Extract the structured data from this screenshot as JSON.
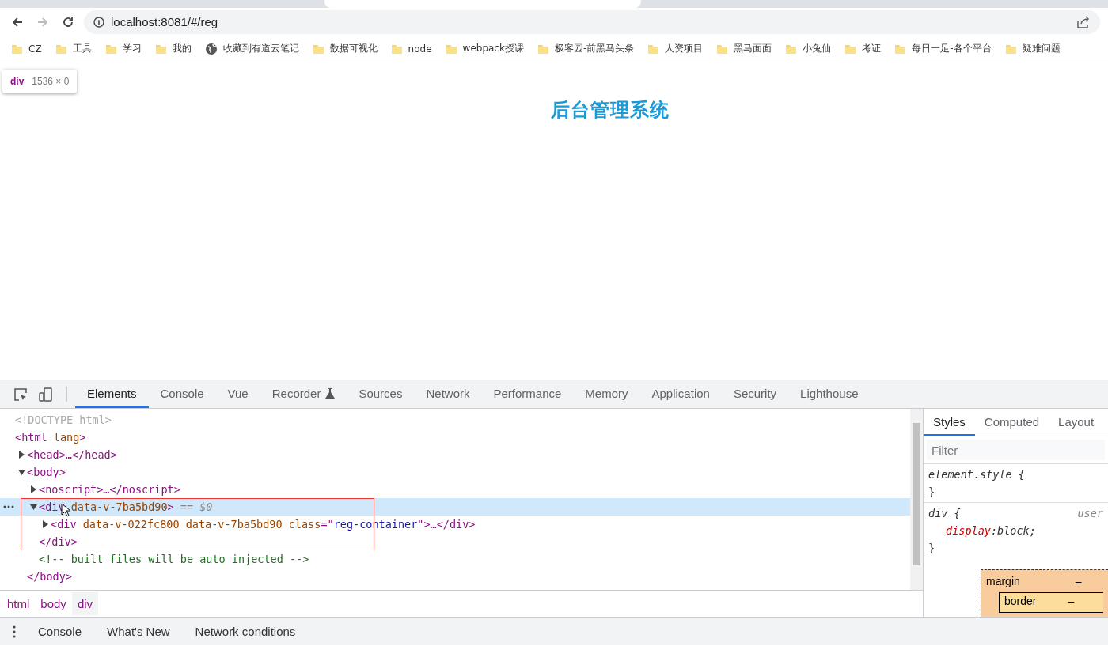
{
  "browser": {
    "url": "localhost:8081/#/reg",
    "bookmarks": [
      {
        "kind": "folder",
        "label": "CZ"
      },
      {
        "kind": "folder",
        "label": "工具"
      },
      {
        "kind": "folder",
        "label": "学习"
      },
      {
        "kind": "folder",
        "label": "我的"
      },
      {
        "kind": "globe",
        "label": "收藏到有道云笔记"
      },
      {
        "kind": "folder",
        "label": "数据可视化"
      },
      {
        "kind": "folder",
        "label": "node"
      },
      {
        "kind": "folder",
        "label": "webpack授课"
      },
      {
        "kind": "folder",
        "label": "极客园-前黑马头条"
      },
      {
        "kind": "folder",
        "label": "人资项目"
      },
      {
        "kind": "folder",
        "label": "黑马面面"
      },
      {
        "kind": "folder",
        "label": "小兔仙"
      },
      {
        "kind": "folder",
        "label": "考证"
      },
      {
        "kind": "folder",
        "label": "每日一足-各个平台"
      },
      {
        "kind": "folder",
        "label": "疑难问题"
      }
    ]
  },
  "page": {
    "tooltip": {
      "tag": "div",
      "size": "1536 × 0"
    },
    "title": "后台管理系统"
  },
  "devtools": {
    "tabs": [
      {
        "kind": "text",
        "label": "Elements",
        "selected": true
      },
      {
        "kind": "text",
        "label": "Console",
        "selected": false
      },
      {
        "kind": "text",
        "label": "Vue",
        "selected": false
      },
      {
        "kind": "icon",
        "label": "Recorder",
        "selected": false
      },
      {
        "kind": "text",
        "label": "Sources",
        "selected": false
      },
      {
        "kind": "text",
        "label": "Network",
        "selected": false
      },
      {
        "kind": "text",
        "label": "Performance",
        "selected": false
      },
      {
        "kind": "text",
        "label": "Memory",
        "selected": false
      },
      {
        "kind": "text",
        "label": "Application",
        "selected": false
      },
      {
        "kind": "text",
        "label": "Security",
        "selected": false
      },
      {
        "kind": "text",
        "label": "Lighthouse",
        "selected": false
      }
    ],
    "dom_tree": [
      {
        "selected": false,
        "tokens": [
          {
            "kind": "doctype",
            "text": "<!DOCTYPE html>"
          }
        ]
      },
      {
        "selected": false,
        "tokens": [
          {
            "kind": "tag",
            "text": "<html"
          },
          {
            "kind": "attr",
            "text": " lang"
          },
          {
            "kind": "tag",
            "text": ">"
          }
        ],
        "children": [
          {
            "selected": false,
            "expanded": false,
            "tokens": [
              {
                "kind": "tag",
                "text": "<head>…</head>"
              }
            ]
          },
          {
            "selected": false,
            "expanded": true,
            "tokens": [
              {
                "kind": "tag",
                "text": "<body>"
              }
            ],
            "close": [
              {
                "kind": "tag",
                "text": "</body>"
              }
            ],
            "children": [
              {
                "selected": false,
                "expanded": false,
                "tokens": [
                  {
                    "kind": "tag",
                    "text": "<noscript>…</noscript>"
                  }
                ]
              },
              {
                "selected": true,
                "expanded": true,
                "tokens": [
                  {
                    "kind": "tag",
                    "text": "<div"
                  },
                  {
                    "kind": "attr",
                    "text": " data-v-7ba5bd90"
                  },
                  {
                    "kind": "tag",
                    "text": ">"
                  },
                  {
                    "kind": "ref",
                    "text": " == $0"
                  }
                ],
                "close": [
                  {
                    "kind": "tag",
                    "text": "</div>"
                  }
                ],
                "children": [
                  {
                    "selected": false,
                    "expanded": false,
                    "tokens": [
                      {
                        "kind": "tag",
                        "text": "<div"
                      },
                      {
                        "kind": "attr",
                        "text": " data-v-022fc800 data-v-7ba5bd90 class"
                      },
                      {
                        "kind": "tag",
                        "text": "=\""
                      },
                      {
                        "kind": "value",
                        "text": "reg-container"
                      },
                      {
                        "kind": "tag",
                        "text": "\">…</div>"
                      }
                    ]
                  }
                ]
              },
              {
                "selected": false,
                "tokens": [
                  {
                    "kind": "comment",
                    "text": "<!-- built files will be auto injected -->"
                  }
                ]
              }
            ]
          }
        ]
      }
    ],
    "breadcrumbs": [
      {
        "label": "html",
        "selected": false
      },
      {
        "label": "body",
        "selected": false
      },
      {
        "label": "div",
        "selected": true
      }
    ],
    "styles": {
      "tabs": [
        {
          "label": "Styles",
          "selected": true
        },
        {
          "label": "Computed",
          "selected": false
        },
        {
          "label": "Layout",
          "selected": false
        }
      ],
      "filter_placeholder": "Filter",
      "rules": [
        {
          "selector": "element.style {",
          "close": "}"
        },
        {
          "selector": "div {",
          "source": "user",
          "declarations": [
            {
              "property": "display",
              "separator": ":",
              "value": "block;"
            }
          ],
          "close": "}"
        }
      ],
      "box_model": {
        "margin_label": "margin",
        "margin_value": "–",
        "border_label": "border",
        "border_value": "–"
      }
    },
    "drawer_tabs": [
      "Console",
      "What's New",
      "Network conditions"
    ]
  }
}
